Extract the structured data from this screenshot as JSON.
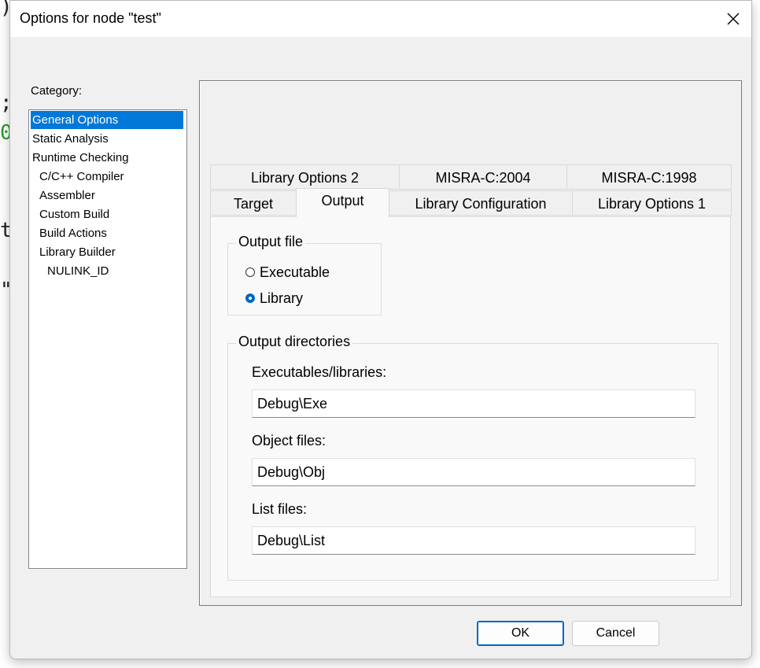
{
  "background_fragments": [
    ")",
    ";",
    "0",
    "t",
    "\""
  ],
  "dialog": {
    "title": "Options for node \"test\"",
    "close_glyph": "close-icon"
  },
  "category": {
    "label": "Category:",
    "items": [
      {
        "label": "General Options",
        "selected": true,
        "indent": 0
      },
      {
        "label": "Static Analysis",
        "selected": false,
        "indent": 0
      },
      {
        "label": "Runtime Checking",
        "selected": false,
        "indent": 0
      },
      {
        "label": "C/C++ Compiler",
        "selected": false,
        "indent": 1
      },
      {
        "label": "Assembler",
        "selected": false,
        "indent": 1
      },
      {
        "label": "Custom Build",
        "selected": false,
        "indent": 1
      },
      {
        "label": "Build Actions",
        "selected": false,
        "indent": 1
      },
      {
        "label": "Library Builder",
        "selected": false,
        "indent": 1
      },
      {
        "label": "NULINK_ID",
        "selected": false,
        "indent": 2
      }
    ]
  },
  "tabs": {
    "row_back": [
      "Library Options 2",
      "MISRA-C:2004",
      "MISRA-C:1998"
    ],
    "row_front": [
      "Target",
      "Output",
      "Library Configuration",
      "Library Options 1"
    ],
    "active": "Output"
  },
  "output_file": {
    "title": "Output file",
    "options": [
      {
        "label": "Executable",
        "checked": false
      },
      {
        "label": "Library",
        "checked": true
      }
    ]
  },
  "output_directories": {
    "title": "Output directories",
    "executables_label": "Executables/libraries:",
    "executables_value": "Debug\\Exe",
    "object_label": "Object files:",
    "object_value": "Debug\\Obj",
    "list_label": "List files:",
    "list_value": "Debug\\List"
  },
  "buttons": {
    "ok": "OK",
    "cancel": "Cancel"
  },
  "colors": {
    "selection": "#0078d7",
    "radio_checked": "#0067c0",
    "default_button_border": "#0067c0"
  }
}
